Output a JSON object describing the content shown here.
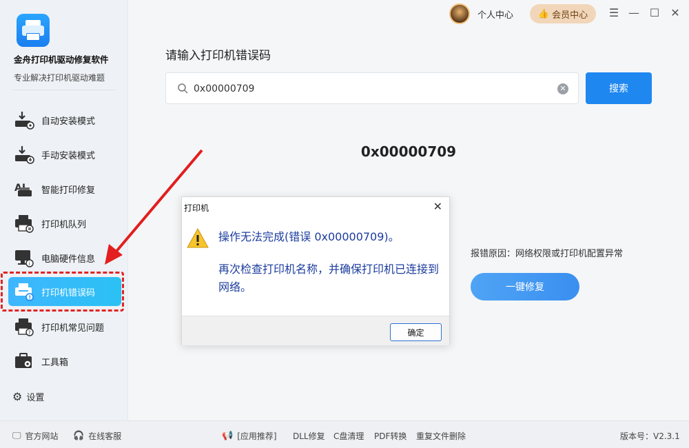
{
  "app": {
    "title": "金舟打印机驱动修复软件",
    "subtitle": "专业解决打印机驱动难题"
  },
  "sidebar": {
    "items": [
      {
        "label": "自动安装模式",
        "icon": "auto-install-icon"
      },
      {
        "label": "手动安装模式",
        "icon": "manual-install-icon"
      },
      {
        "label": "智能打印修复",
        "icon": "ai-repair-icon"
      },
      {
        "label": "打印机队列",
        "icon": "printer-queue-icon"
      },
      {
        "label": "电脑硬件信息",
        "icon": "hardware-info-icon"
      },
      {
        "label": "打印机错误码",
        "icon": "error-code-icon",
        "active": true
      },
      {
        "label": "打印机常见问题",
        "icon": "faq-icon"
      },
      {
        "label": "工具箱",
        "icon": "toolbox-icon"
      }
    ],
    "settings_label": "设置"
  },
  "header": {
    "user_center": "个人中心",
    "vip_label": "会员中心"
  },
  "main": {
    "prompt": "请输入打印机错误码",
    "search_value": "0x00000709",
    "search_button": "搜索",
    "result_code": "0x00000709",
    "reason": "报错原因：网络权限或打印机配置异常",
    "fix_button": "一键修复"
  },
  "dialog": {
    "title": "打印机",
    "message_line1": "操作无法完成(错误 0x00000709)。",
    "message_line2": "再次检查打印机名称，并确保打印机已连接到网络。",
    "ok_button": "确定"
  },
  "footer": {
    "official_site": "官方网站",
    "online_service": "在线客服",
    "recommend": "[应用推荐]",
    "links": [
      "DLL修复",
      "C盘清理",
      "PDF转换",
      "重复文件删除"
    ],
    "version": "版本号：V2.3.1"
  },
  "colors": {
    "accent": "#1e87f0",
    "active_nav": "#3fb6ff",
    "highlight_red": "#e02424",
    "dialog_text": "#1c3c9e"
  }
}
